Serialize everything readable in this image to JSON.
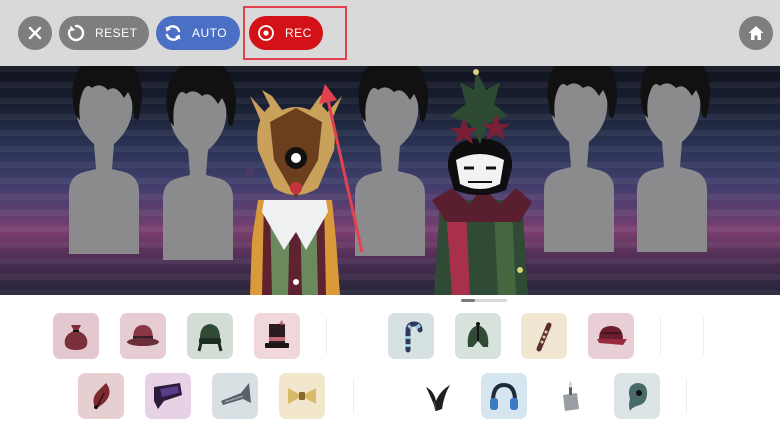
{
  "toolbar": {
    "close": {
      "icon": "close-icon"
    },
    "reset": {
      "label": "RESET",
      "icon": "reset-icon",
      "color": "#7e7e7e"
    },
    "auto": {
      "label": "AUTO",
      "icon": "sync-icon",
      "color": "#4b6fc4"
    },
    "rec": {
      "label": "REC",
      "icon": "record-icon",
      "color": "#d31217"
    },
    "home": {
      "icon": "home-icon"
    }
  },
  "stage": {
    "slots": [
      "empty",
      "empty",
      "empty",
      "deer-mask-character",
      "empty",
      "star-jester-character",
      "empty",
      "empty"
    ]
  },
  "tray": {
    "row1": [
      {
        "icon": "sack-icon",
        "color": "#e3c9cf"
      },
      {
        "icon": "bowler-hat-icon",
        "color": "#e5cdd3"
      },
      {
        "icon": "winter-hat-icon",
        "color": "#d4dcd6"
      },
      {
        "icon": "top-hat-icon",
        "color": "#f0d7dc"
      },
      {
        "icon": "candy-cane-icon",
        "color": "#d6e1e4"
      },
      {
        "icon": "helmet-icon",
        "color": "#d8e2dc"
      },
      {
        "icon": "bat-icon",
        "color": "#f1e6d2"
      },
      {
        "icon": "cap-icon",
        "color": "#e8cfd6"
      }
    ],
    "row2": [
      {
        "icon": "feather-icon",
        "color": "#e6cfd0"
      },
      {
        "icon": "horn-speaker-icon",
        "color": "#e6d2e4"
      },
      {
        "icon": "trumpet-icon",
        "color": "#d9e0e4"
      },
      {
        "icon": "bowtie-icon",
        "color": "#f2e6cc"
      },
      {
        "icon": "claw-icon",
        "color": "#ffffff"
      },
      {
        "icon": "headphones-icon",
        "color": "#d6e6f0"
      },
      {
        "icon": "candle-icon",
        "color": "#ffffff"
      },
      {
        "icon": "ghost-icon",
        "color": "#dde4e6"
      }
    ]
  }
}
